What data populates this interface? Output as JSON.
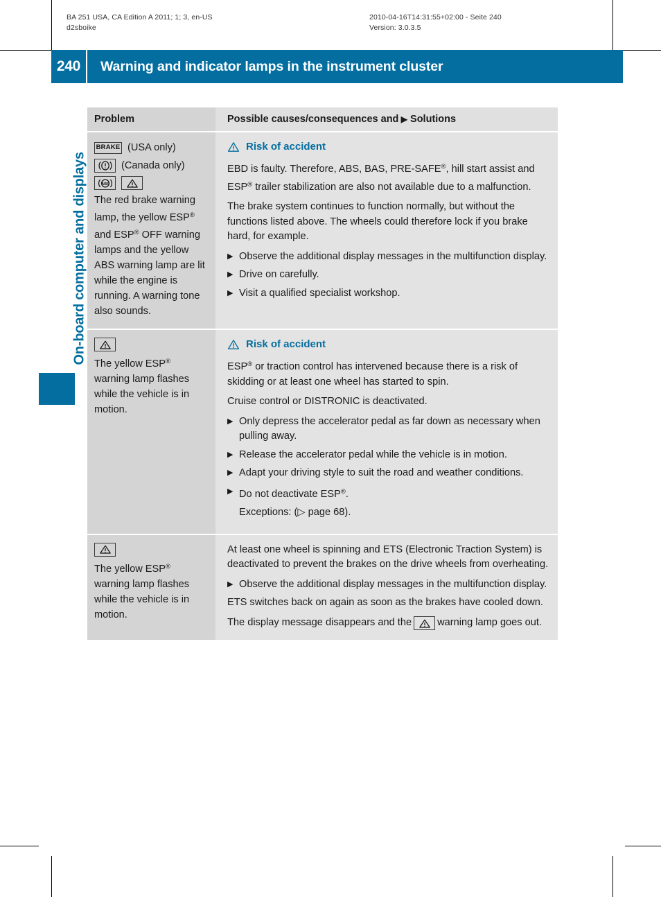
{
  "print_meta": {
    "left": "BA 251 USA, CA Edition A 2011; 1; 3, en-US\nd2sboike",
    "right": "2010-04-16T14:31:55+02:00 - Seite 240\nVersion: 3.0.3.5"
  },
  "header": {
    "page_number": "240",
    "title": "Warning and indicator lamps in the instrument cluster",
    "accent_color": "#046ea0"
  },
  "chapter": {
    "label": "On-board computer and displays"
  },
  "table": {
    "columns": {
      "problem": "Problem",
      "solutions_prefix": "Possible causes/consequences and",
      "solutions_marker": "▶",
      "solutions_suffix": "Solutions"
    },
    "rows": [
      {
        "problem": {
          "icons": [
            {
              "name": "brake-lamp-icon",
              "glyph": "BRAKE",
              "note": "(USA only)"
            },
            {
              "name": "brake-circle-lamp-icon",
              "glyph": "(!)",
              "note": "(Canada only)"
            },
            {
              "name": "abs-lamp-icon",
              "glyph": "ABS",
              "note": ""
            },
            {
              "name": "esp-warning-triangle-icon",
              "glyph": "⚠",
              "note": ""
            }
          ],
          "text": "The red brake warning lamp, the yellow ESP® and ESP® OFF warning lamps and the yellow ABS warning lamp are lit while the engine is running. A warning tone also sounds."
        },
        "solution": {
          "warning_heading": "Risk of accident",
          "paragraphs": [
            "EBD is faulty. Therefore, ABS, BAS, PRE-SAFE®, hill start assist and ESP® trailer stabilization are also not available due to a malfunction.",
            "The brake system continues to function normally, but without the functions listed above. The wheels could therefore lock if you brake hard, for example."
          ],
          "bullets": [
            "Observe the additional display messages in the multifunction display.",
            "Drive on carefully.",
            "Visit a qualified specialist workshop."
          ]
        }
      },
      {
        "problem": {
          "icons": [
            {
              "name": "esp-warning-triangle-icon",
              "glyph": "⚠",
              "note": ""
            }
          ],
          "text": "The yellow ESP® warning lamp flashes while the vehicle is in motion."
        },
        "solution": {
          "warning_heading": "Risk of accident",
          "paragraphs": [
            "ESP® or traction control has intervened because there is a risk of skidding or at least one wheel has started to spin.",
            "Cruise control or DISTRONIC is deactivated."
          ],
          "bullets": [
            "Only depress the accelerator pedal as far down as necessary when pulling away.",
            "Release the accelerator pedal while the vehicle is in motion.",
            "Adapt your driving style to suit the road and weather conditions.",
            "Do not deactivate ESP®."
          ],
          "cross_reference": "Exceptions: (▷ page 68)."
        }
      },
      {
        "problem": {
          "icons": [
            {
              "name": "esp-warning-triangle-icon",
              "glyph": "⚠",
              "note": ""
            }
          ],
          "text": "The yellow ESP® warning lamp flashes while the vehicle is in motion."
        },
        "solution": {
          "warning_heading": "",
          "paragraphs": [
            "At least one wheel is spinning and ETS (Electronic Traction System) is deactivated to prevent the brakes on the drive wheels from overheating."
          ],
          "bullets": [
            "Observe the additional display messages in the multifunction display."
          ],
          "trailing_paragraphs": [
            "ETS switches back on again as soon as the brakes have cooled down."
          ],
          "final_before_icon": "The display message disappears and the",
          "final_after_icon": "warning lamp goes out."
        }
      }
    ]
  }
}
